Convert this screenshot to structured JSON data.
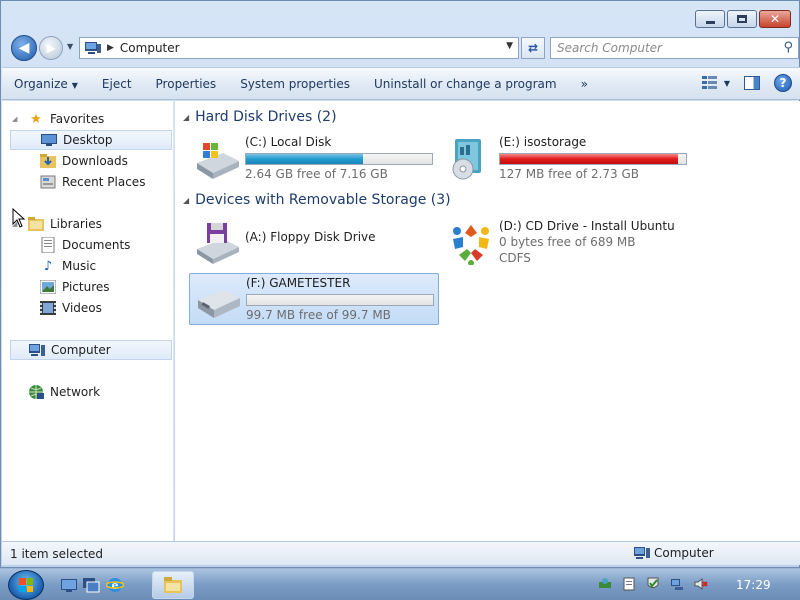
{
  "window": {
    "caption_buttons": [
      "minimize",
      "maximize",
      "close"
    ]
  },
  "address_bar": {
    "crumb": "Computer",
    "search_placeholder": "Search Computer"
  },
  "toolbar": {
    "items": [
      "Organize",
      "Eject",
      "Properties",
      "System properties",
      "Uninstall or change a program",
      "»"
    ]
  },
  "nav": {
    "favorites": "Favorites",
    "desktop": "Desktop",
    "downloads": "Downloads",
    "recent_places": "Recent Places",
    "libraries": "Libraries",
    "documents": "Documents",
    "music": "Music",
    "pictures": "Pictures",
    "videos": "Videos",
    "computer": "Computer",
    "network": "Network"
  },
  "content": {
    "group_hdd": "Hard Disk Drives (2)",
    "group_removable": "Devices with Removable Storage (3)",
    "drives": [
      {
        "name": "(C:) Local Disk",
        "free": "2.64 GB free of 7.16 GB",
        "used_fraction": 0.63,
        "bar_color": "#239bcf"
      },
      {
        "name": "(E:) isostorage",
        "free": "127 MB free of 2.73 GB",
        "used_fraction": 0.955,
        "bar_color": "#e21b1b"
      },
      {
        "name": "(A:) Floppy Disk Drive"
      },
      {
        "name": "(D:) CD Drive - Install Ubuntu",
        "free": "0 bytes free of 689 MB",
        "fs": "CDFS"
      },
      {
        "name": "(F:) GAMETESTER",
        "free": "99.7 MB free of 99.7 MB",
        "used_fraction": 0.0
      }
    ]
  },
  "status": {
    "selection": "1 item selected",
    "location": "Computer"
  },
  "taskbar": {
    "clock": "17:29"
  }
}
